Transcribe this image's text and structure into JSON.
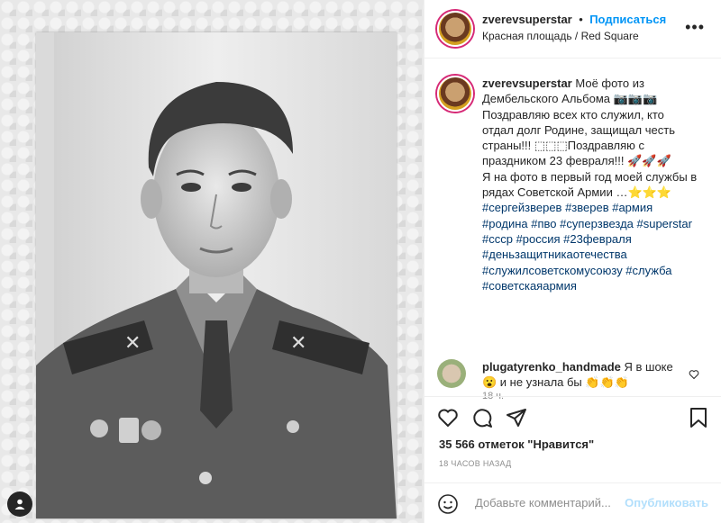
{
  "header": {
    "username": "zverevsuperstar",
    "separator": "•",
    "follow_label": "Подписаться",
    "location": "Красная площадь / Red Square",
    "more_icon": "more-horizontal-icon"
  },
  "caption": {
    "username": "zverevsuperstar",
    "text": "Моё фото из Дембельского Альбома 📷📷📷\nПоздравляю всех кто служил, кто отдал долг Родине, защищал честь страны!!! ⬚⬚⬚Поздравляю с праздником 23 февраля!!! 🚀🚀🚀\nЯ на фото в первый год моей службы в рядах Советской Армии …⭐⭐⭐",
    "hashtags": "#сергейзверев #зверев #армия #родина #пво #суперзвезда #superstar #ссср #россия #23февраля #деньзащитникаотечества #служилсоветскомусоюзу #служба #советскаяармия",
    "time": "18 ч."
  },
  "comment": {
    "username": "plugatyrenko_handmade",
    "text": "Я в шоке😮 и не узнала бы 👏👏👏"
  },
  "actions": {
    "likes": "35 566 отметок \"Нравится\"",
    "posted": "18 ЧАСОВ НАЗАД"
  },
  "comment_box": {
    "placeholder": "Добавьте комментарий...",
    "publish_label": "Опубликовать"
  },
  "colors": {
    "accent": "#0095f6",
    "hashtag": "#00376b",
    "muted": "#8e8e8e"
  }
}
